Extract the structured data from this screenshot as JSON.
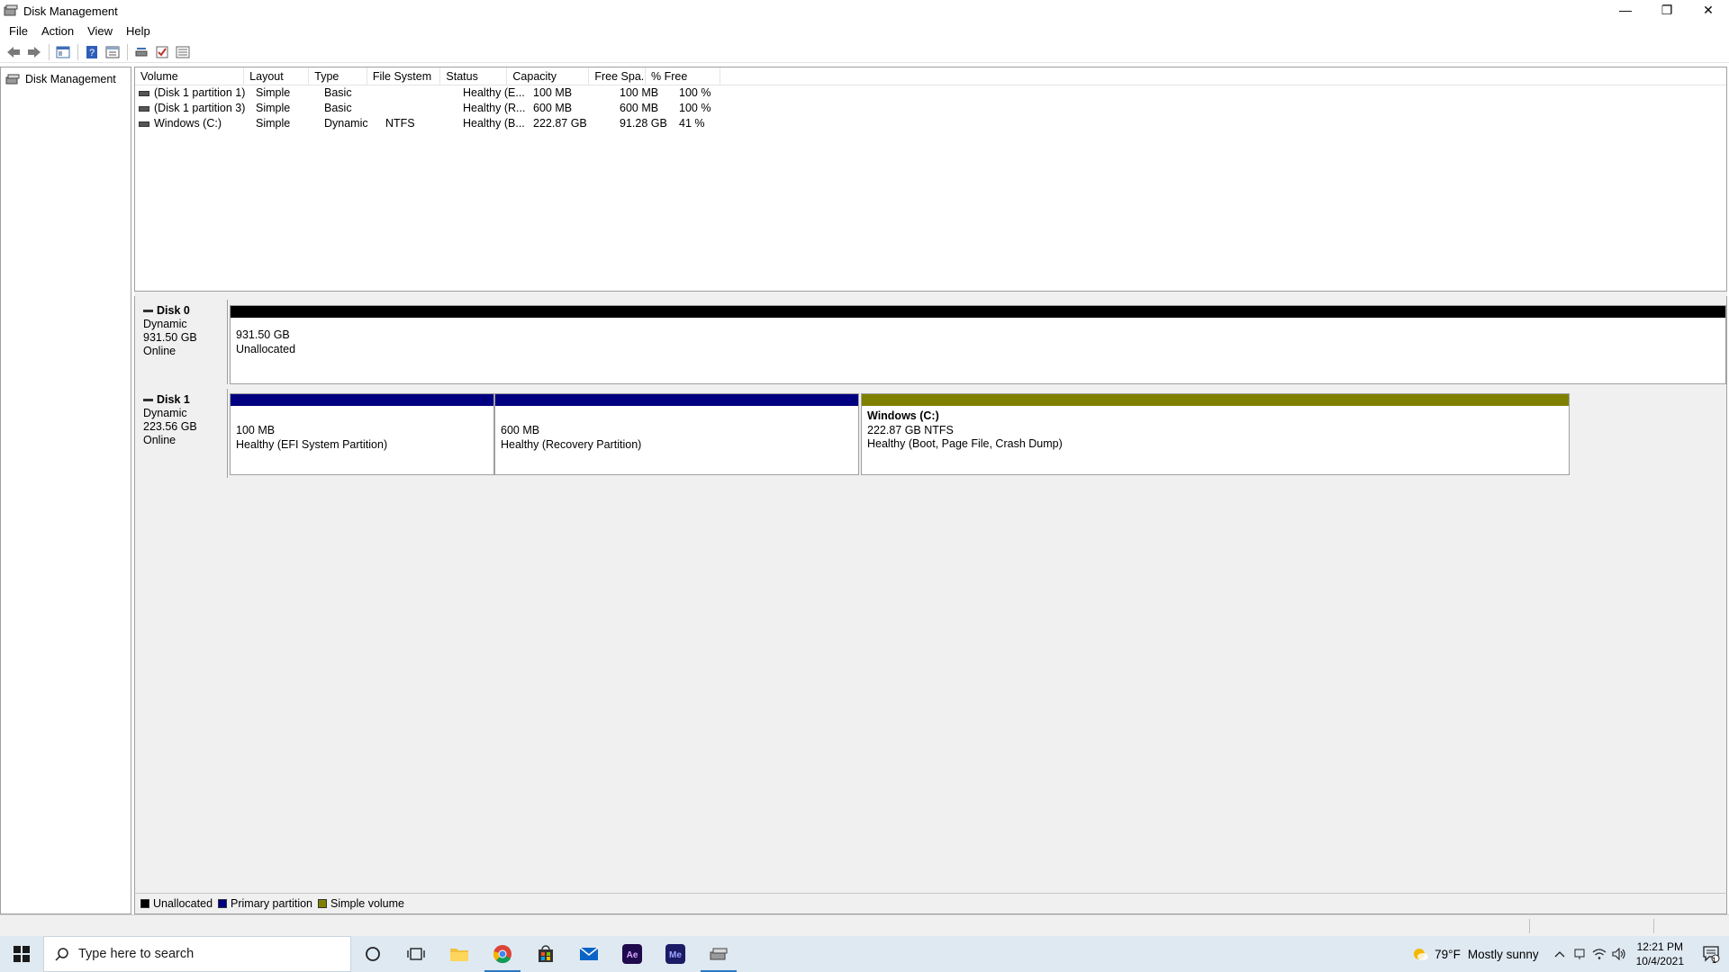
{
  "window": {
    "title": "Disk Management",
    "controls": {
      "minimize": "—",
      "restore": "❐",
      "close": "✕"
    }
  },
  "menu": [
    "File",
    "Action",
    "View",
    "Help"
  ],
  "toolbar": {
    "buttons": [
      "back-arrow-icon",
      "forward-arrow-icon",
      "console-tree-icon",
      "help-icon",
      "properties-icon",
      "rescan-icon",
      "check-icon",
      "list-icon"
    ]
  },
  "tree": {
    "root_label": "Disk Management"
  },
  "volume_list": {
    "columns": [
      "Volume",
      "Layout",
      "Type",
      "File System",
      "Status",
      "Capacity",
      "Free Spa...",
      "% Free",
      ""
    ],
    "rows": [
      {
        "volume": "(Disk 1 partition 1)",
        "layout": "Simple",
        "type": "Basic",
        "fs": "",
        "status": "Healthy (E...",
        "capacity": "100 MB",
        "free": "100 MB",
        "pct": "100 %"
      },
      {
        "volume": "(Disk 1 partition 3)",
        "layout": "Simple",
        "type": "Basic",
        "fs": "",
        "status": "Healthy (R...",
        "capacity": "600 MB",
        "free": "600 MB",
        "pct": "100 %"
      },
      {
        "volume": "Windows (C:)",
        "layout": "Simple",
        "type": "Dynamic",
        "fs": "NTFS",
        "status": "Healthy (B...",
        "capacity": "222.87 GB",
        "free": "91.28 GB",
        "pct": "41 %"
      }
    ]
  },
  "disks": [
    {
      "name": "Disk 0",
      "type": "Dynamic",
      "size": "931.50 GB",
      "state": "Online",
      "partitions": [
        {
          "title": "",
          "line1": "931.50 GB",
          "line2": "Unallocated",
          "color": "#000000"
        }
      ]
    },
    {
      "name": "Disk 1",
      "type": "Dynamic",
      "size": "223.56 GB",
      "state": "Online",
      "partitions": [
        {
          "title": "",
          "line1": "100 MB",
          "line2": "Healthy (EFI System Partition)",
          "color": "#000080"
        },
        {
          "title": "",
          "line1": "600 MB",
          "line2": "Healthy (Recovery Partition)",
          "color": "#000080"
        },
        {
          "title": "Windows  (C:)",
          "line1": "222.87 GB NTFS",
          "line2": "Healthy (Boot, Page File, Crash Dump)",
          "color": "#808000"
        }
      ]
    }
  ],
  "legend": [
    {
      "label": "Unallocated",
      "color": "#000000"
    },
    {
      "label": "Primary partition",
      "color": "#000080"
    },
    {
      "label": "Simple volume",
      "color": "#808000"
    }
  ],
  "taskbar": {
    "search_placeholder": "Type here to search",
    "apps": [
      "cortana-icon",
      "task-view-icon",
      "file-explorer-icon",
      "chrome-icon",
      "store-icon",
      "mail-icon",
      "after-effects-icon",
      "media-encoder-icon",
      "disk-management-icon"
    ],
    "weather": {
      "temp": "79°F",
      "desc": "Mostly sunny"
    },
    "clock": {
      "time": "12:21 PM",
      "date": "10/4/2021"
    },
    "notification_count": "1"
  }
}
